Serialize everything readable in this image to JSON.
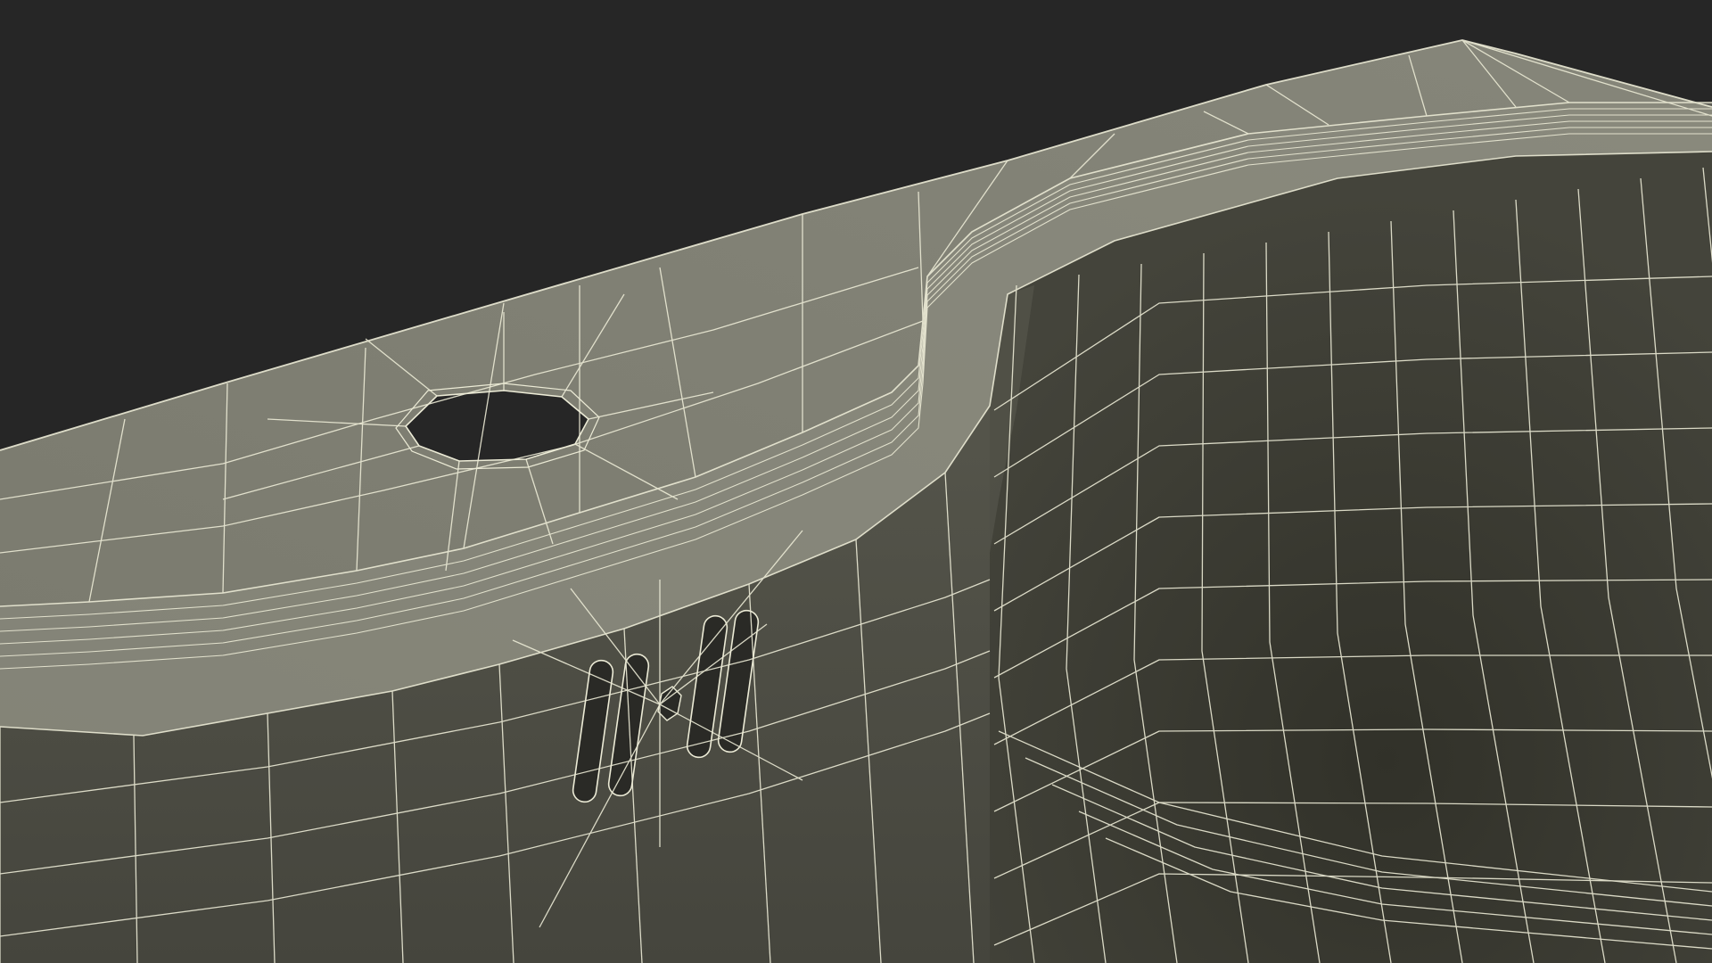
{
  "scene": {
    "subject": "sink-basin-wireframe-render",
    "colors": {
      "background": "#262626",
      "rim_top": "#7e7e72",
      "rim_bevel": "#8a8a7e",
      "wall_front": "#4b4b42",
      "basin_inner": "#3a3a32",
      "hole": "#262626",
      "wire": "#ecebd6"
    }
  }
}
